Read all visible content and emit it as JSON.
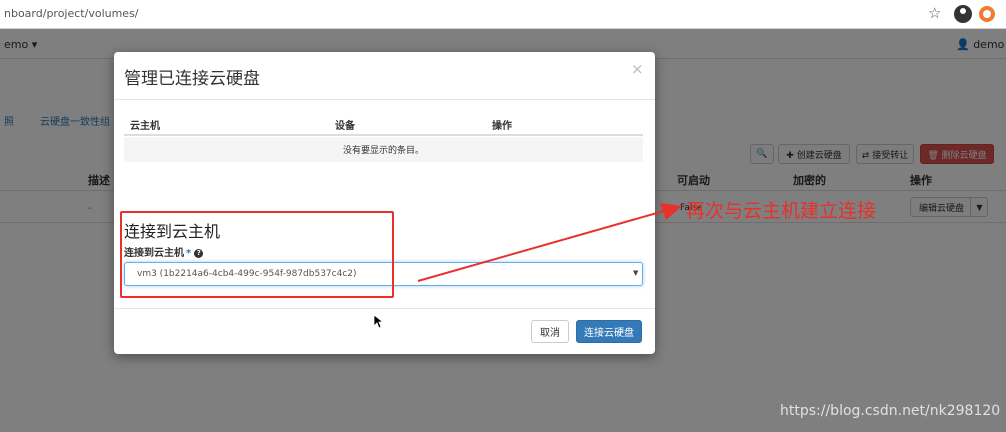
{
  "browser": {
    "url": "nboard/project/volumes/",
    "icons": [
      "star-icon",
      "account-icon",
      "extension-icon"
    ]
  },
  "dashboard": {
    "project_menu": "emo ▾",
    "user_menu": "demo ▾",
    "tabs": [
      "照",
      "云硬盘一致性组"
    ],
    "toolbar": {
      "create": "✚ 创建云硬盘",
      "transfer": "⇄ 接受转让",
      "delete": "🗑 删除云硬盘"
    },
    "columns": {
      "description": "描述",
      "bootable": "可启动",
      "encrypted": "加密的",
      "actions": "操作"
    },
    "row": {
      "description": "-",
      "bootable": "False",
      "action": "编辑云硬盘"
    }
  },
  "modal": {
    "title": "管理已连接云硬盘",
    "close": "×",
    "table": {
      "headers": [
        "云主机",
        "设备",
        "操作"
      ],
      "empty": "没有要显示的条目。"
    },
    "section_title": "连接到云主机",
    "field_label": "连接到云主机",
    "required_mark": "*",
    "help": "?",
    "selected_instance": "vm3 (1b2214a6-4cb4-499c-954f-987db537c4c2)",
    "cancel": "取消",
    "submit": "连接云硬盘"
  },
  "annotation": {
    "text": "再次与云主机建立连接",
    "color": "#e8302c"
  },
  "watermark": "https://blog.csdn.net/nk298120",
  "colors": {
    "primary": "#337ab7",
    "danger": "#d9534f",
    "annotation": "#e8302c"
  }
}
